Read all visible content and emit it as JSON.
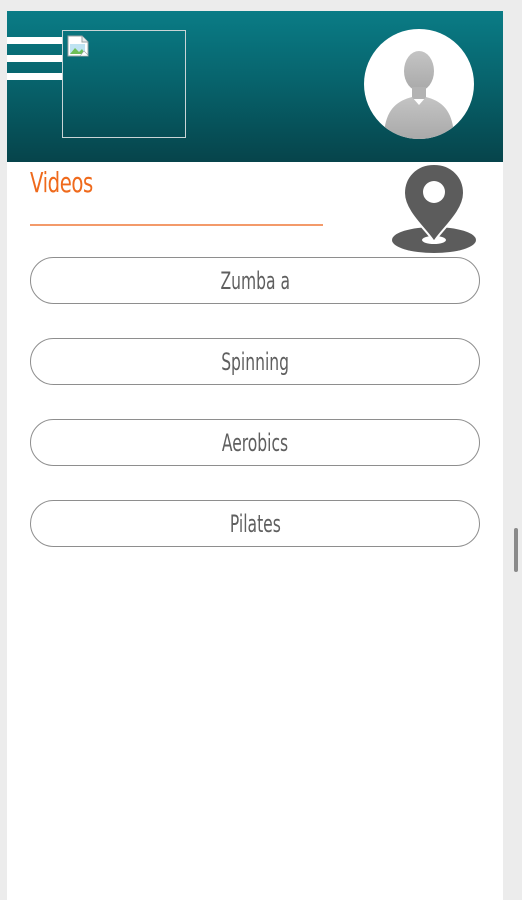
{
  "header": {
    "menu_icon": "hamburger-menu-icon",
    "logo_icon": "broken-image-icon",
    "avatar_icon": "user-silhouette-icon"
  },
  "main": {
    "title": "Videos",
    "location_icon": "map-pin-icon",
    "videos": [
      {
        "label": "Zumba a"
      },
      {
        "label": "Spinning"
      },
      {
        "label": "Aerobics"
      },
      {
        "label": "Pilates"
      }
    ]
  },
  "colors": {
    "header_top": "#0a7c86",
    "header_bottom": "#06444b",
    "title_accent": "#ef6a1c",
    "button_border": "#8e8e8e",
    "button_text": "#5f5f5f",
    "icon_gray": "#5c5c5c"
  }
}
